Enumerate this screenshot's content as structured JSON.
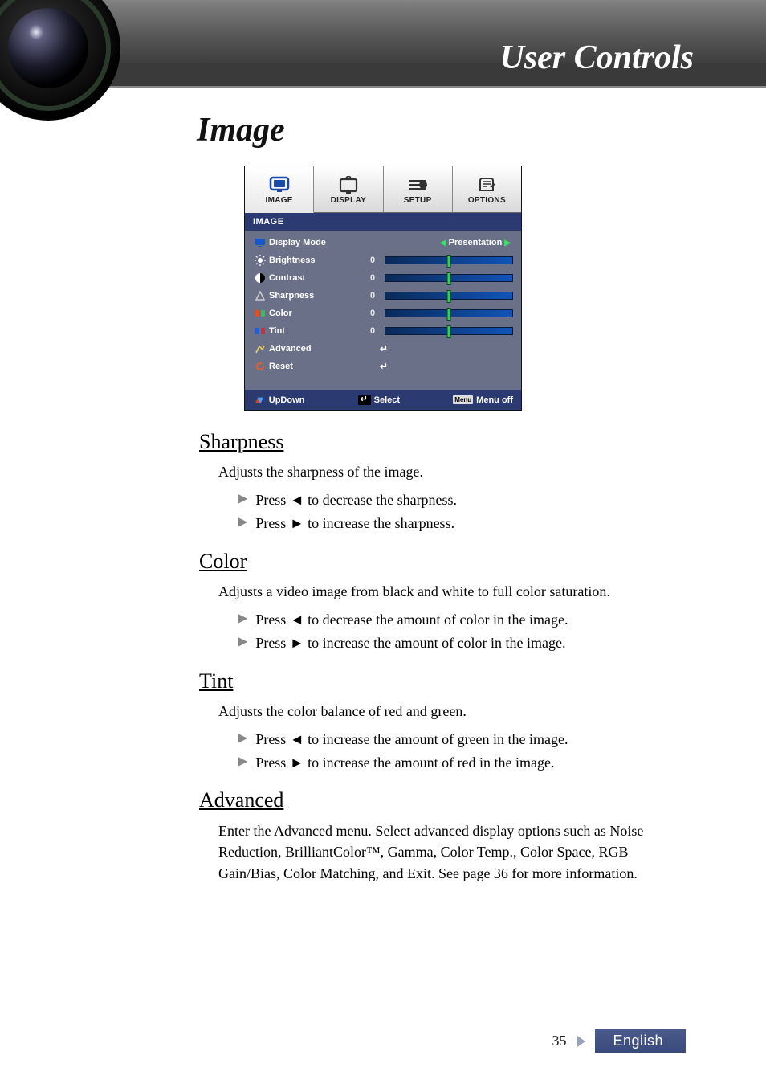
{
  "header": {
    "title": "User Controls"
  },
  "page_heading": "Image",
  "osd": {
    "tabs": [
      {
        "label": "IMAGE",
        "icon": "monitor-icon",
        "active": true
      },
      {
        "label": "DISPLAY",
        "icon": "display-icon",
        "active": false
      },
      {
        "label": "SETUP",
        "icon": "setup-icon",
        "active": false
      },
      {
        "label": "OPTIONS",
        "icon": "options-icon",
        "active": false
      }
    ],
    "crumb": "IMAGE",
    "rows": [
      {
        "kind": "dropdown",
        "label": "Display Mode",
        "value": "Presentation",
        "icon": "monitor-icon"
      },
      {
        "kind": "slider",
        "label": "Brightness",
        "value": "0",
        "icon": "sun-icon"
      },
      {
        "kind": "slider",
        "label": "Contrast",
        "value": "0",
        "icon": "contrast-icon"
      },
      {
        "kind": "slider",
        "label": "Sharpness",
        "value": "0",
        "icon": "sharpness-icon"
      },
      {
        "kind": "slider",
        "label": "Color",
        "value": "0",
        "icon": "color-icon"
      },
      {
        "kind": "slider",
        "label": "Tint",
        "value": "0",
        "icon": "tint-icon"
      },
      {
        "kind": "enter",
        "label": "Advanced",
        "icon": "advanced-icon"
      },
      {
        "kind": "enter",
        "label": "Reset",
        "icon": "reset-icon"
      }
    ],
    "footer": {
      "updown": "UpDown",
      "select": "Select",
      "menuoff": "Menu off",
      "menu_label": "Menu"
    }
  },
  "sections": [
    {
      "title": "Sharpness",
      "desc": "Adjusts the sharpness of the image.",
      "bullets": [
        "Press ◄ to decrease the sharpness.",
        "Press ► to increase the sharpness."
      ]
    },
    {
      "title": "Color",
      "desc": "Adjusts a video image from black and white to full color saturation.",
      "bullets": [
        "Press ◄ to decrease the amount of color in the image.",
        "Press ► to increase the amount of color in the image."
      ]
    },
    {
      "title": "Tint",
      "desc": "Adjusts the color balance of red and green.",
      "bullets": [
        "Press ◄ to increase the amount of green in the image.",
        "Press ► to increase the amount of red in the image."
      ]
    },
    {
      "title": "Advanced",
      "desc_block": "Enter the Advanced menu. Select advanced display options such as Noise Reduction, BrilliantColor™, Gamma, Color Temp., Color Space, RGB Gain/Bias, Color Matching, and Exit. See page 36 for more information."
    }
  ],
  "footer": {
    "page": "35",
    "language": "English"
  }
}
